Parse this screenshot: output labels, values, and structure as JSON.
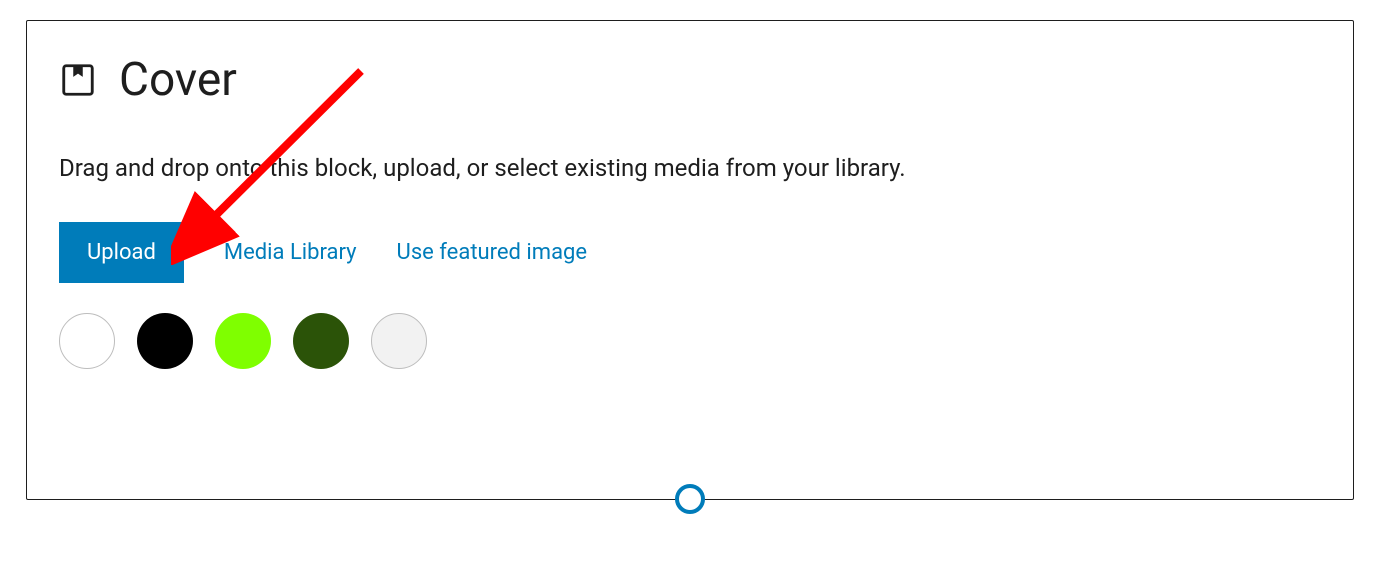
{
  "block": {
    "title": "Cover",
    "description": "Drag and drop onto this block, upload, or select existing media from your library.",
    "actions": {
      "upload_label": "Upload",
      "media_library_label": "Media Library",
      "featured_image_label": "Use featured image"
    },
    "colors": [
      {
        "name": "white",
        "value": "#ffffff",
        "bordered": true
      },
      {
        "name": "black",
        "value": "#000000",
        "bordered": false
      },
      {
        "name": "lime-green",
        "value": "#7fff00",
        "bordered": false
      },
      {
        "name": "dark-green",
        "value": "#2b5308",
        "bordered": false
      },
      {
        "name": "light-gray",
        "value": "#f2f2f2",
        "bordered": true
      }
    ],
    "annotation": {
      "arrow_color": "#ff0000"
    }
  }
}
